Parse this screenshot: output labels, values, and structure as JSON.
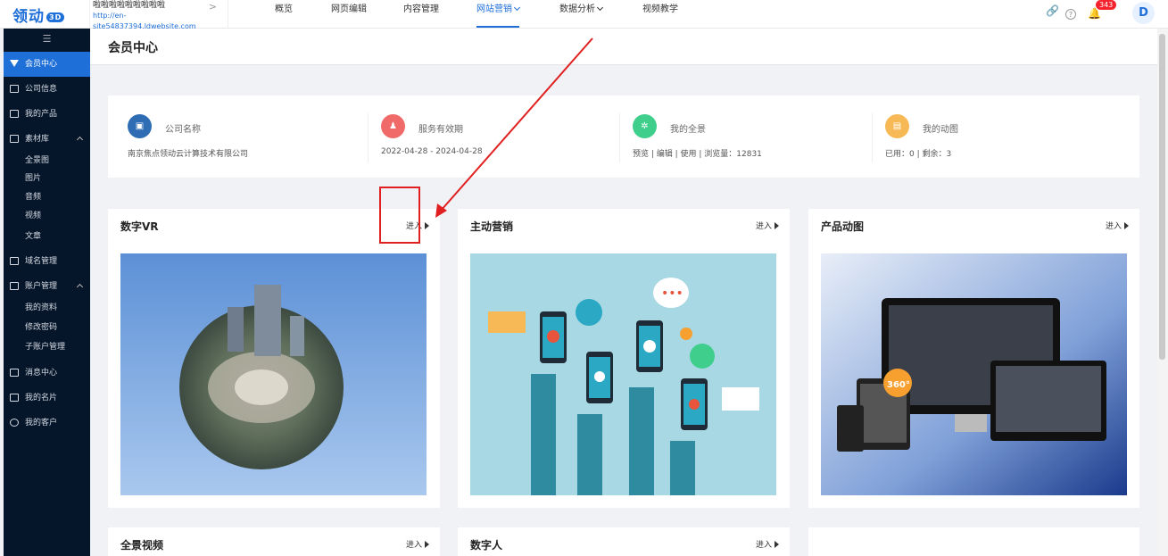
{
  "app": {
    "logo_text": "领动",
    "logo_badge": "3D"
  },
  "site": {
    "name": "啦啦啦啦啦啦啦啦啦",
    "url": "http://en-site54837394.ldwebsite.com",
    "chevron": ">"
  },
  "nav": [
    {
      "label": "概览"
    },
    {
      "label": "网页编辑"
    },
    {
      "label": "内容管理"
    },
    {
      "label": "网站营销",
      "active": true,
      "dropdown": true
    },
    {
      "label": "数据分析",
      "dropdown": true
    },
    {
      "label": "视频教学"
    }
  ],
  "top_icons": {
    "link": "🔗",
    "help": "?",
    "bell": "🔔",
    "notif_count": "343",
    "avatar": "D"
  },
  "sidebar": {
    "collapse_icon": "☰",
    "items": [
      {
        "label": "会员中心"
      },
      {
        "label": "公司信息"
      },
      {
        "label": "我的产品"
      },
      {
        "label": "素材库"
      },
      {
        "label": "全景图"
      },
      {
        "label": "图片"
      },
      {
        "label": "音频"
      },
      {
        "label": "视频"
      },
      {
        "label": "文章"
      },
      {
        "label": "域名管理"
      },
      {
        "label": "账户管理"
      },
      {
        "label": "我的资料"
      },
      {
        "label": "修改密码"
      },
      {
        "label": "子账户管理"
      },
      {
        "label": "消息中心"
      },
      {
        "label": "我的名片"
      },
      {
        "label": "我的客户"
      }
    ]
  },
  "page": {
    "title": "会员中心"
  },
  "info": [
    {
      "label": "公司名称",
      "value": "南京焦点领动云计算技术有限公司",
      "icon": "building-icon",
      "color": "#2e6db4"
    },
    {
      "label": "服务有效期",
      "value": "2022-04-28 - 2024-04-28",
      "icon": "user-icon",
      "color": "#f06a6a"
    },
    {
      "label": "我的全景",
      "value": "预览 | 编辑 | 使用 | 浏览量：12831",
      "icon": "panorama-icon",
      "color": "#3fce8c"
    },
    {
      "label": "我的动图",
      "value": "已用：0 | 剩余：3",
      "icon": "image-icon",
      "color": "#f7b955"
    }
  ],
  "cards": [
    {
      "title": "数字VR",
      "enter": "进入"
    },
    {
      "title": "主动营销",
      "enter": "进入"
    },
    {
      "title": "产品动图",
      "enter": "进入"
    },
    {
      "title": "全景视频",
      "enter": "进入"
    },
    {
      "title": "数字人",
      "enter": "进入"
    }
  ],
  "colors": {
    "primary": "#1e6fd8",
    "sidebar_bg": "#05152a",
    "annotation_red": "#e02020"
  }
}
